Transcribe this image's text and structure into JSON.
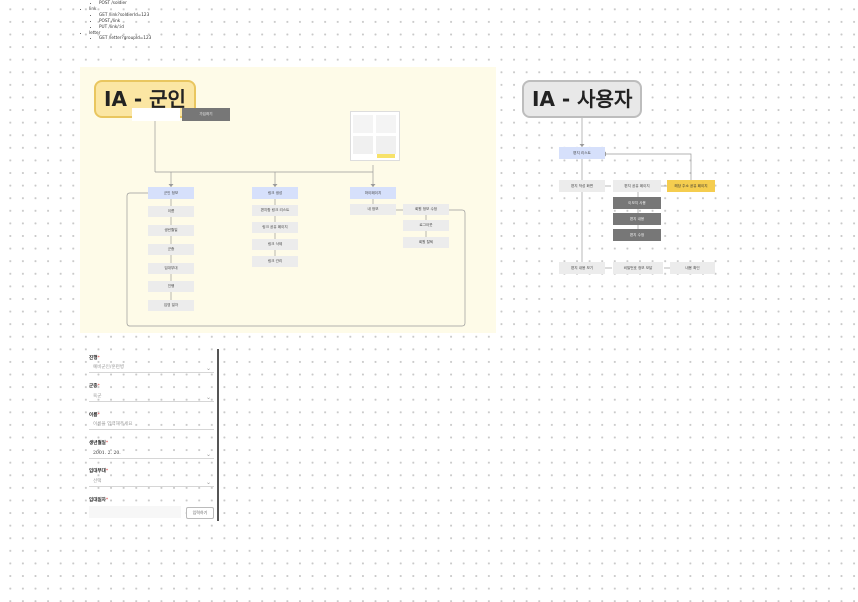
{
  "api": {
    "top_item": "POST /soldier",
    "groups": [
      {
        "name": "link",
        "items": [
          "GET /link?soldierId=123",
          "POST /link",
          "PUT /link/:id"
        ]
      },
      {
        "name": "letter",
        "items": [
          "GET /letter?groupId=123"
        ]
      }
    ]
  },
  "ia_soldier": {
    "title": "IA - 군인",
    "button": "가입하기",
    "branches": [
      {
        "label": "군인 정보",
        "children": [
          "이름",
          "생년월일",
          "군종",
          "입대부대",
          "진행",
          "입영 일자"
        ]
      },
      {
        "label": "링크 생성",
        "children": [
          "편지함 링크 리스트",
          "링크 공유 페이지",
          "링크 삭제",
          "링크 관리"
        ]
      },
      {
        "label": "마이페이지",
        "children": [
          "내 정보"
        ]
      }
    ],
    "extra": [
      "회원 정보 수정",
      "로그아웃",
      "회원 탈퇴"
    ]
  },
  "ia_user": {
    "title": "IA - 사용자",
    "root": "편지 리스트",
    "row1": [
      "편지 작성 화면",
      "편지 공유 페이지",
      "해당 주소 공유 페이지"
    ],
    "dark_items": [
      "이모지 사용",
      "편지 내용",
      "편지 수정"
    ],
    "row2": [
      "편지 내용 보기",
      "비밀번호 정보 모달",
      "내용 확인"
    ]
  },
  "form": {
    "fields": [
      {
        "label": "진행",
        "value": "예비군인/훈련병",
        "dark": false,
        "select": true
      },
      {
        "label": "군종",
        "value": "육군",
        "dark": false,
        "select": true
      },
      {
        "label": "이름",
        "value": "이름을 입력해주세요",
        "dark": false,
        "select": false
      },
      {
        "label": "생년월일",
        "value": "2001. 2. 20.",
        "dark": true,
        "select": true
      },
      {
        "label": "입대부대",
        "value": "선택",
        "dark": false,
        "select": true
      }
    ],
    "last_label": "입대일자",
    "required_mark": "*",
    "button": "입력하기",
    "chevron": "⌄"
  }
}
